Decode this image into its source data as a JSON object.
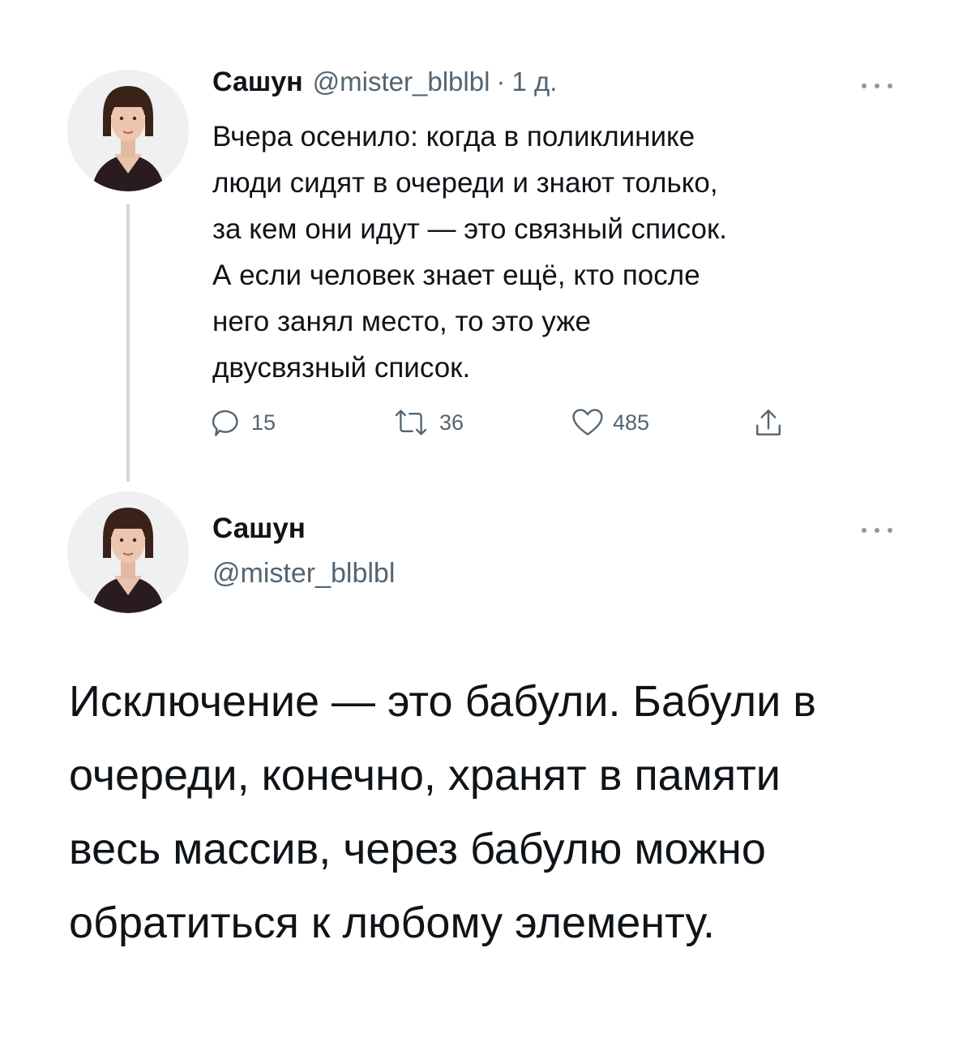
{
  "tweet1": {
    "author_name": "Сашун",
    "handle": "@mister_blblbl",
    "separator": "·",
    "time": "1 д.",
    "avatar_icon": "user-avatar-photo",
    "more_icon": "more-dots-icon",
    "body_lines": [
      "Вчера осенило: когда в поликлинике",
      "люди сидят в очереди и знают только,",
      "за кем они идут — это связный список.",
      "А если человек знает ещё, кто после",
      "него занял место, то это уже",
      "двусвязный список."
    ],
    "actions": {
      "reply_count": "15",
      "retweet_count": "36",
      "like_count": "485"
    }
  },
  "tweet2": {
    "author_name": "Сашун",
    "handle": "@mister_blblbl",
    "avatar_icon": "user-avatar-photo",
    "more_icon": "more-dots-icon",
    "body_lines": [
      "Исключение — это бабули. Бабули в",
      "очереди, конечно, хранят в памяти",
      "весь массив, через бабулю можно",
      "обратиться к любому элементу."
    ]
  },
  "colors": {
    "text_primary": "#0f1419",
    "text_secondary": "#536471",
    "thread_line": "#cfd9de"
  }
}
